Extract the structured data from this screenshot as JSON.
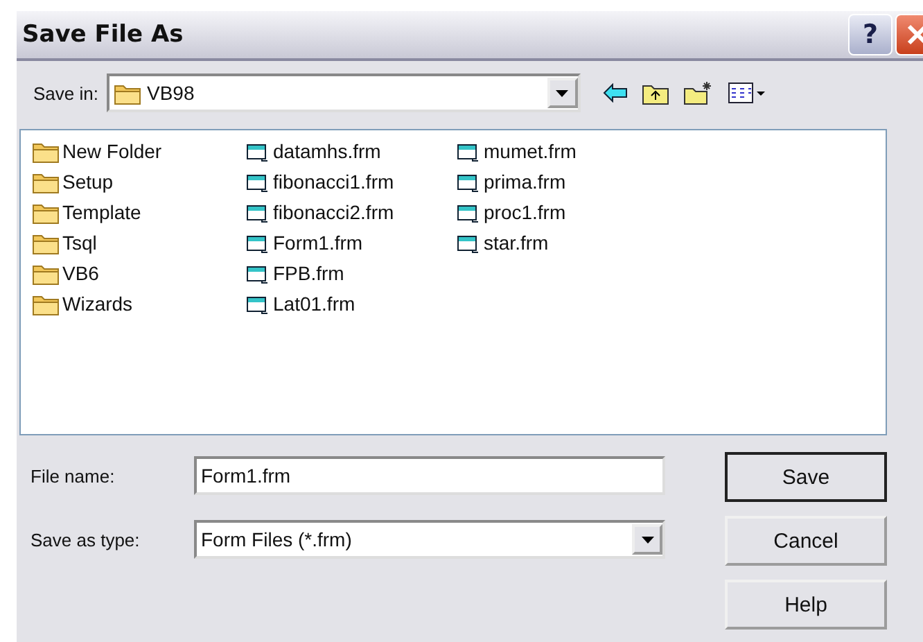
{
  "window": {
    "title": "Save File As",
    "help_button": "?"
  },
  "save_in": {
    "label": "Save in:",
    "value": "VB98"
  },
  "files": [
    {
      "name": "New Folder",
      "kind": "folder"
    },
    {
      "name": "Setup",
      "kind": "folder"
    },
    {
      "name": "Template",
      "kind": "folder"
    },
    {
      "name": "Tsql",
      "kind": "folder"
    },
    {
      "name": "VB6",
      "kind": "folder"
    },
    {
      "name": "Wizards",
      "kind": "folder"
    },
    {
      "name": "datamhs.frm",
      "kind": "form"
    },
    {
      "name": "fibonacci1.frm",
      "kind": "form"
    },
    {
      "name": "fibonacci2.frm",
      "kind": "form"
    },
    {
      "name": "Form1.frm",
      "kind": "form"
    },
    {
      "name": "FPB.frm",
      "kind": "form"
    },
    {
      "name": "Lat01.frm",
      "kind": "form"
    },
    {
      "name": "mumet.frm",
      "kind": "form"
    },
    {
      "name": "prima.frm",
      "kind": "form"
    },
    {
      "name": "proc1.frm",
      "kind": "form"
    },
    {
      "name": "star.frm",
      "kind": "form"
    }
  ],
  "file_name": {
    "label": "File name:",
    "value": "Form1.frm"
  },
  "save_as_type": {
    "label": "Save as type:",
    "value": "Form Files (*.frm)"
  },
  "buttons": [
    {
      "label": "Save",
      "default": true
    },
    {
      "label": "Cancel",
      "default": false
    },
    {
      "label": "Help",
      "default": false
    }
  ]
}
